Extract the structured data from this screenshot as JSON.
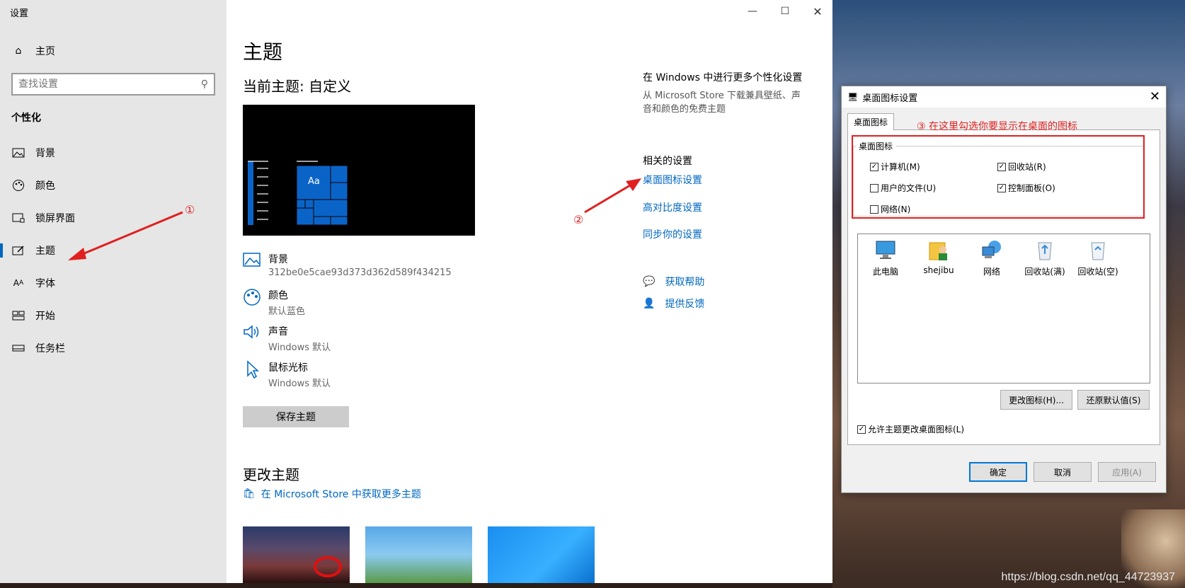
{
  "window": {
    "title": "设置",
    "min": "—",
    "max": "☐",
    "close": "✕"
  },
  "sidebar": {
    "home": "主页",
    "search_placeholder": "查找设置",
    "section": "个性化",
    "items": [
      {
        "label": "背景",
        "icon": "picture-icon"
      },
      {
        "label": "颜色",
        "icon": "palette-icon"
      },
      {
        "label": "锁屏界面",
        "icon": "lockscreen-icon"
      },
      {
        "label": "主题",
        "icon": "theme-icon"
      },
      {
        "label": "字体",
        "icon": "font-icon"
      },
      {
        "label": "开始",
        "icon": "start-icon"
      },
      {
        "label": "任务栏",
        "icon": "taskbar-icon"
      }
    ]
  },
  "main": {
    "title": "主题",
    "current_theme": "当前主题: 自定义",
    "preview_text": "Aa",
    "props": [
      {
        "title": "背景",
        "value": "312be0e5cae93d373d362d589f434215"
      },
      {
        "title": "颜色",
        "value": "默认蓝色"
      },
      {
        "title": "声音",
        "value": "Windows 默认"
      },
      {
        "title": "鼠标光标",
        "value": "Windows 默认"
      }
    ],
    "save_button": "保存主题",
    "change_theme": "更改主题",
    "store_link": "在 Microsoft Store 中获取更多主题"
  },
  "right": {
    "more_title": "在 Windows 中进行更多个性化设置",
    "more_desc": "从 Microsoft Store 下载兼具壁纸、声音和颜色的免费主题",
    "related_title": "相关的设置",
    "links": [
      "桌面图标设置",
      "高对比度设置",
      "同步你的设置"
    ],
    "help": "获取帮助",
    "feedback": "提供反馈"
  },
  "annotations": {
    "a1": "①",
    "a2": "②",
    "a3": "③ 在这里勾选你要显示在桌面的图标"
  },
  "dialog": {
    "title": "桌面图标设置",
    "tab": "桌面图标",
    "group": "桌面图标",
    "checkboxes": [
      {
        "label": "计算机(M)",
        "checked": true
      },
      {
        "label": "回收站(R)",
        "checked": true
      },
      {
        "label": "用户的文件(U)",
        "checked": false
      },
      {
        "label": "控制面板(O)",
        "checked": true
      },
      {
        "label": "网络(N)",
        "checked": false
      }
    ],
    "icons": [
      "此电脑",
      "shejibu",
      "网络",
      "回收站(满)",
      "回收站(空)"
    ],
    "change_icon": "更改图标(H)...",
    "restore_default": "还原默认值(S)",
    "allow_theme": "允许主题更改桌面图标(L)",
    "ok": "确定",
    "cancel": "取消",
    "apply": "应用(A)"
  },
  "watermark": "https://blog.csdn.net/qq_44723937",
  "colors": {
    "accent": "#0067c0",
    "annotation_red": "#e02020"
  }
}
